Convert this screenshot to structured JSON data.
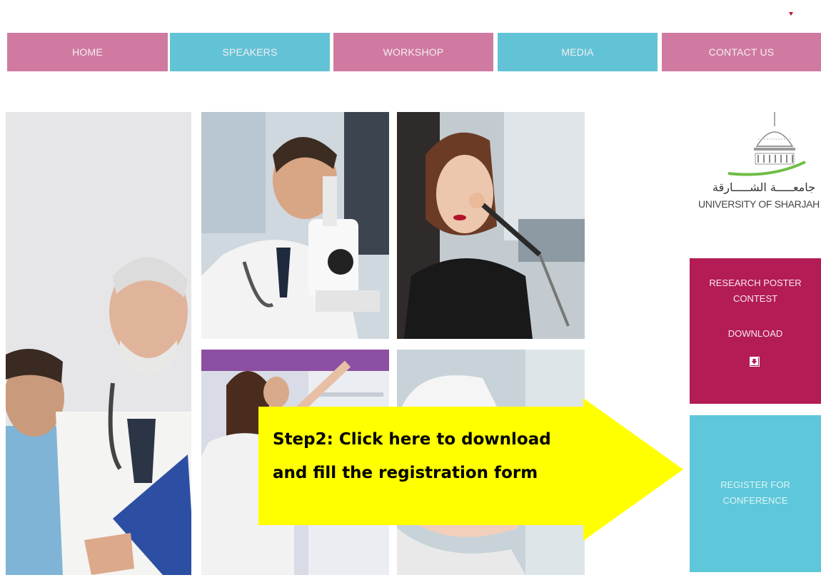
{
  "nav": {
    "items": [
      {
        "label": "HOME",
        "color": "#d07aa1"
      },
      {
        "label": "SPEAKERS",
        "color": "#62c3d6"
      },
      {
        "label": "WORKSHOP",
        "color": "#d07aa1"
      },
      {
        "label": "MEDIA",
        "color": "#62c3d6"
      },
      {
        "label": "CONTACT US",
        "color": "#d07aa1"
      }
    ]
  },
  "logo": {
    "arabic_name": "جامعـــــة الشـــــارقة",
    "english_name": "UNIVERSITY OF SHARJAH"
  },
  "poster_panel": {
    "line1": "RESEARCH POSTER",
    "line2": "CONTEST",
    "download_label": "DOWNLOAD",
    "color": "#b31c55"
  },
  "register_panel": {
    "line1": "REGISTER FOR",
    "line2": "CONFERENCE",
    "color": "#5ec7da"
  },
  "callout": {
    "line1": "Step2: Click here to download",
    "line2": "and fill the registration form",
    "color": "#ffff00"
  },
  "photos": [
    {
      "name": "doctors-team-photo"
    },
    {
      "name": "scientist-microscope-photo"
    },
    {
      "name": "woman-makeup-photo"
    },
    {
      "name": "pharmacists-photo"
    },
    {
      "name": "skincare-treatment-photo"
    }
  ]
}
